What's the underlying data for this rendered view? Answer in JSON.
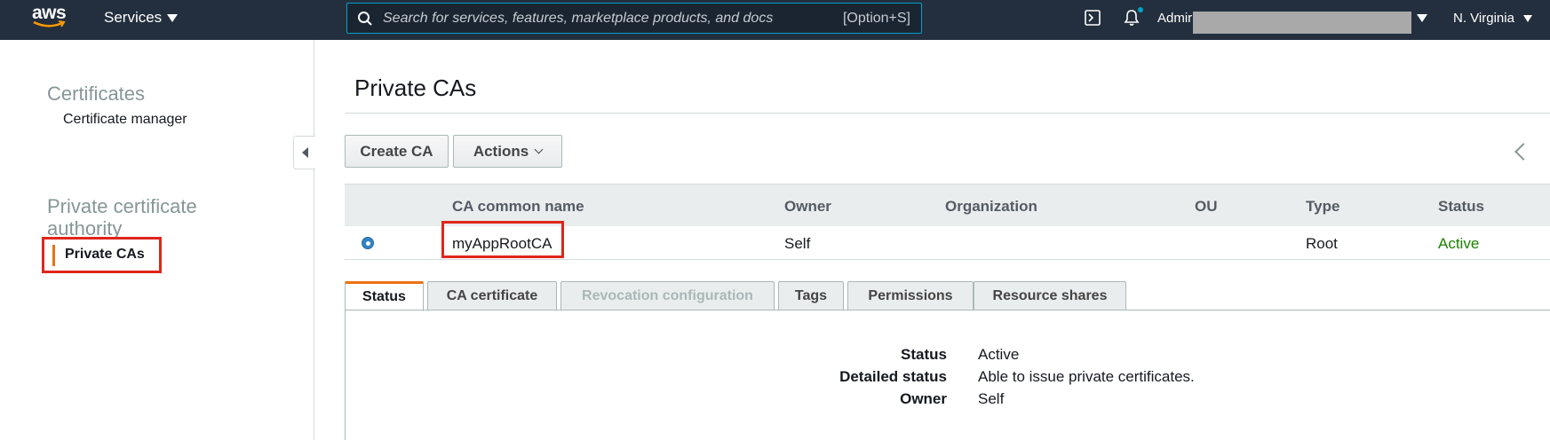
{
  "topnav": {
    "logo": "aws",
    "services_label": "Services",
    "search_placeholder": "Search for services, features, marketplace products, and docs",
    "search_shortcut": "[Option+S]",
    "account_label": "Admir",
    "region_label": "N. Virginia",
    "icons": [
      "cloudshell-icon",
      "bell-icon",
      "search-icon"
    ]
  },
  "sidebar": {
    "section1_title": "Certificates",
    "section1_link": "Certificate manager",
    "section2_title": "Private certificate authority",
    "active_item": "Private CAs"
  },
  "main": {
    "title": "Private CAs",
    "create_button": "Create CA",
    "actions_button": "Actions",
    "table": {
      "columns": [
        "CA common name",
        "Owner",
        "Organization",
        "OU",
        "Type",
        "Status"
      ],
      "rows": [
        {
          "name": "myAppRootCA",
          "owner": "Self",
          "organization": "",
          "ou": "",
          "type": "Root",
          "status": "Active",
          "selected": true
        }
      ]
    },
    "tabs": [
      {
        "label": "Status",
        "state": "active"
      },
      {
        "label": "CA certificate",
        "state": "normal"
      },
      {
        "label": "Revocation configuration",
        "state": "disabled"
      },
      {
        "label": "Tags",
        "state": "normal"
      },
      {
        "label": "Permissions",
        "state": "normal"
      },
      {
        "label": "Resource shares",
        "state": "normal"
      }
    ],
    "details": {
      "status_label": "Status",
      "status_value": "Active",
      "detailed_label": "Detailed status",
      "detailed_value": "Able to issue private certificates.",
      "owner_label": "Owner",
      "owner_value": "Self"
    }
  },
  "colors": {
    "nav_bg": "#232f3e",
    "accent_orange": "#ec7211",
    "highlight_red": "#e0251b",
    "status_green": "#1d8102",
    "search_border": "#00a1c9"
  }
}
